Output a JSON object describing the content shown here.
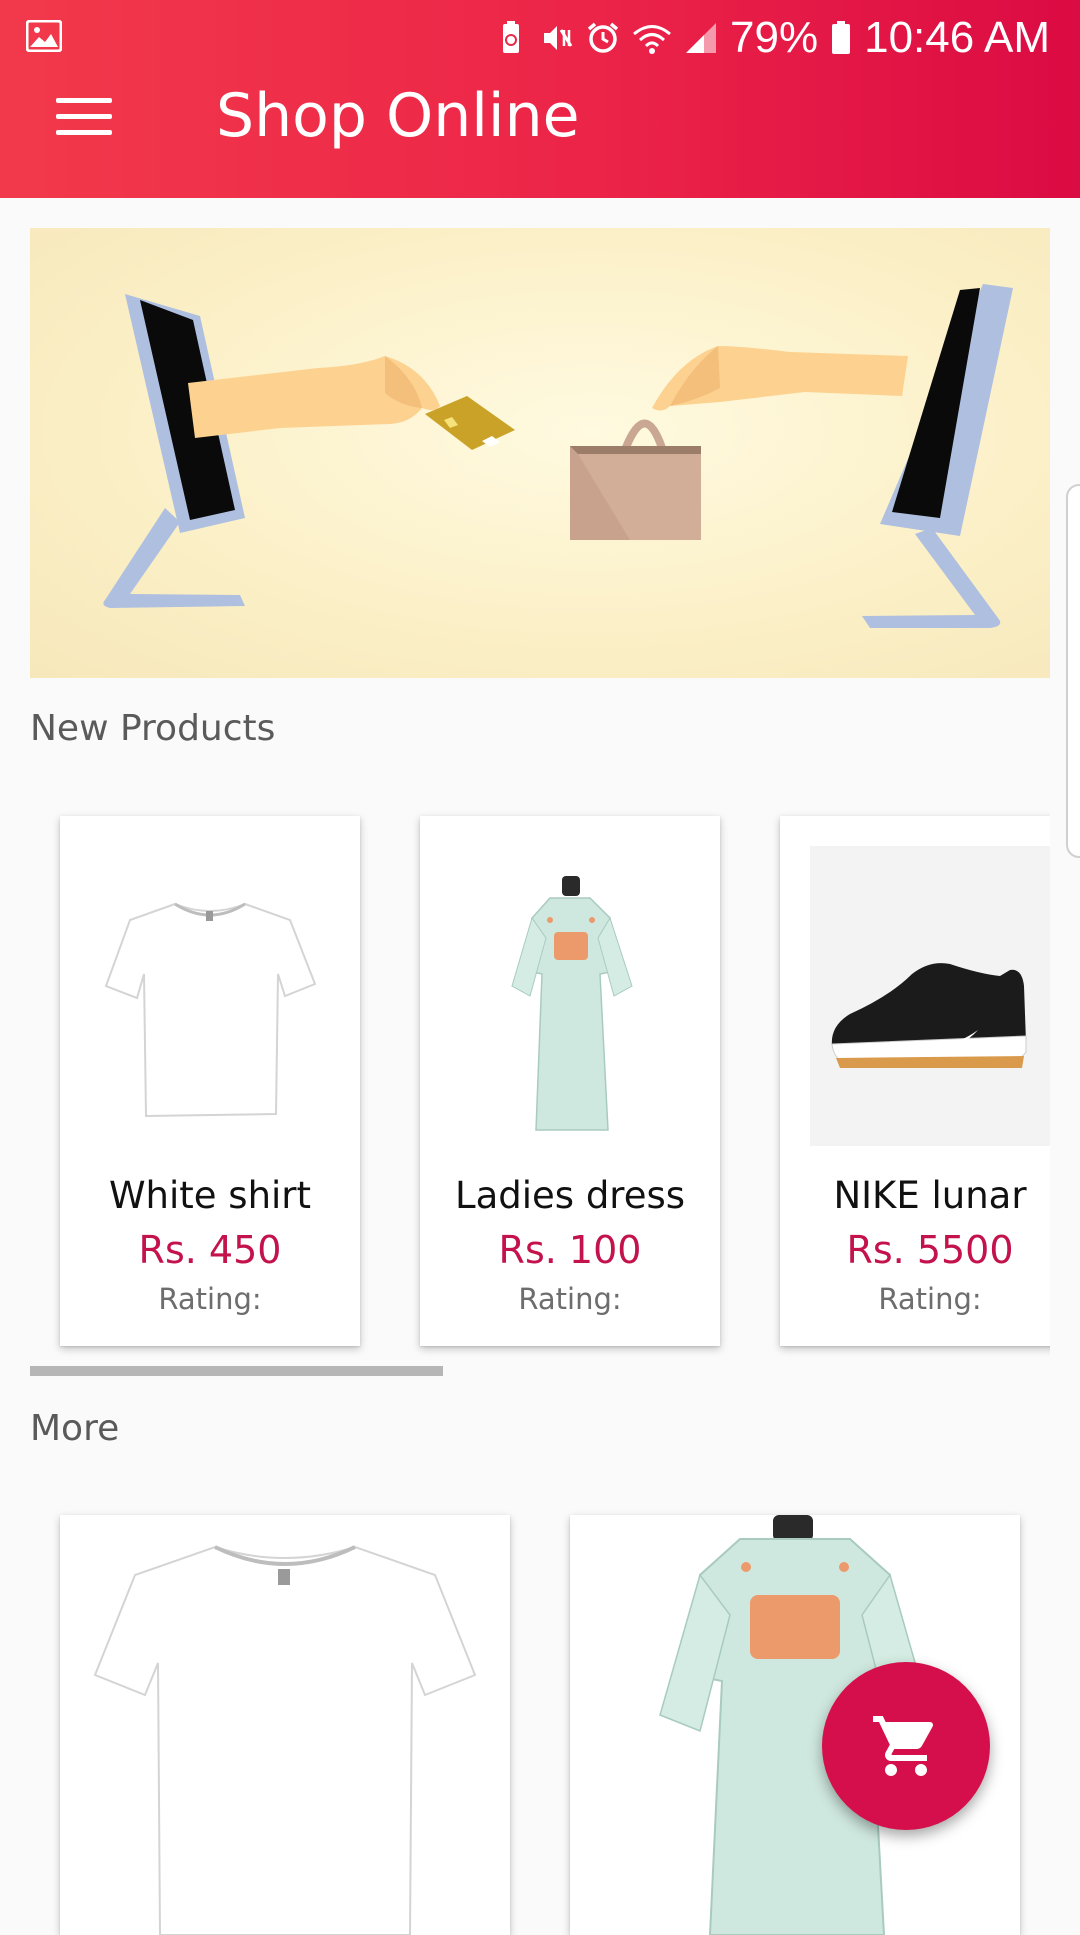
{
  "status_bar": {
    "battery_percent": "79%",
    "time": "10:46 AM"
  },
  "app_bar": {
    "title": "Shop Online",
    "menu_icon": "hamburger-menu-icon"
  },
  "banner": {
    "illustration": "online-shopping-illustration"
  },
  "new_products": {
    "title": "New Products",
    "items": [
      {
        "name": "White shirt",
        "price": "Rs. 450",
        "rating_label": "Rating:"
      },
      {
        "name": "Ladies dress",
        "price": "Rs. 100",
        "rating_label": "Rating:"
      },
      {
        "name": "NIKE lunar",
        "price": "Rs. 5500",
        "rating_label": "Rating:"
      }
    ],
    "scroll_progress": 0.33
  },
  "more": {
    "title": "More"
  },
  "fab": {
    "icon": "shopping-cart-icon"
  },
  "colors": {
    "appbar_start": "#f2394b",
    "appbar_end": "#db0b43",
    "price": "#c3124c",
    "fab": "#d50f4b"
  }
}
